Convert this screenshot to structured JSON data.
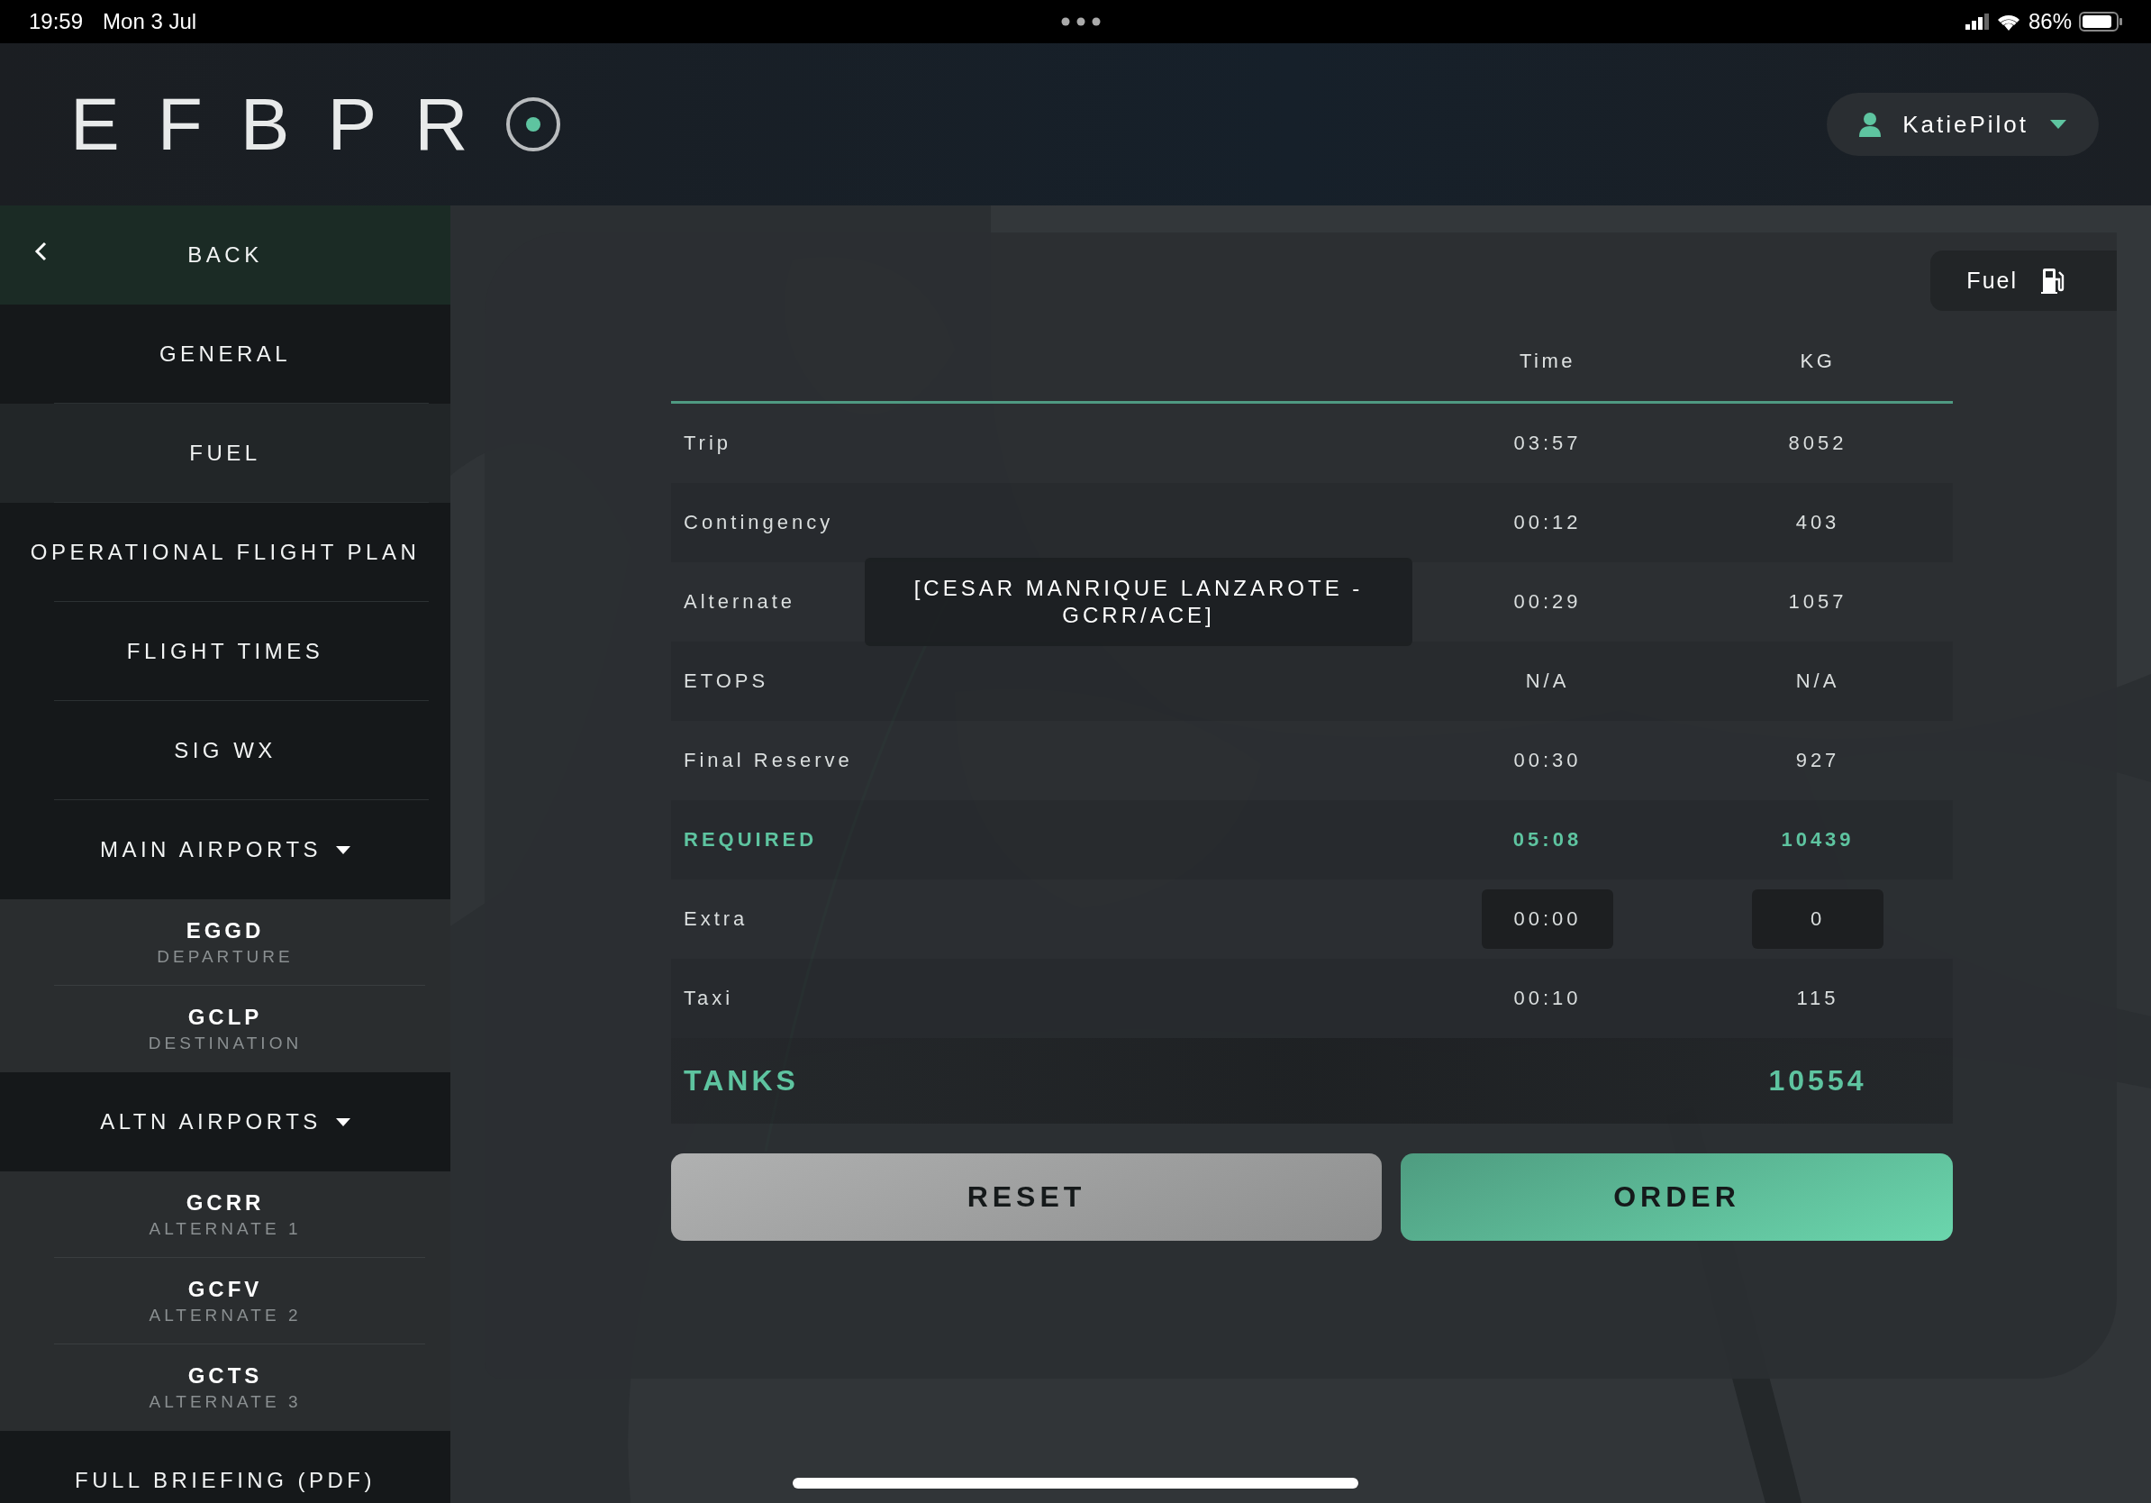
{
  "status_bar": {
    "time": "19:59",
    "date": "Mon 3 Jul",
    "battery": "86%"
  },
  "header": {
    "logo": "EFBPR",
    "user": "KatiePilot"
  },
  "sidebar": {
    "items": [
      {
        "kind": "back",
        "label": "BACK"
      },
      {
        "kind": "item",
        "label": "GENERAL",
        "selected": false
      },
      {
        "kind": "item",
        "label": "FUEL",
        "selected": true
      },
      {
        "kind": "item",
        "label": "OPERATIONAL FLIGHT PLAN",
        "selected": false
      },
      {
        "kind": "item",
        "label": "FLIGHT TIMES",
        "selected": false
      },
      {
        "kind": "item",
        "label": "SIG WX",
        "selected": false
      },
      {
        "kind": "group",
        "label": "MAIN AIRPORTS",
        "expanded": true,
        "children": [
          {
            "code": "EGGD",
            "role": "DEPARTURE",
            "selected": false
          },
          {
            "code": "GCLP",
            "role": "DESTINATION",
            "selected": false
          }
        ]
      },
      {
        "kind": "group",
        "label": "ALTN AIRPORTS",
        "expanded": true,
        "children": [
          {
            "code": "GCRR",
            "role": "ALTERNATE 1",
            "selected": false
          },
          {
            "code": "GCFV",
            "role": "ALTERNATE 2",
            "selected": false
          },
          {
            "code": "GCTS",
            "role": "ALTERNATE 3",
            "selected": false
          }
        ]
      },
      {
        "kind": "item",
        "label": "FULL BRIEFING (PDF)",
        "selected": false
      }
    ]
  },
  "fuel_panel": {
    "tab": "Fuel",
    "columns": [
      "Time",
      "KG"
    ],
    "rows": [
      {
        "kind": "normal",
        "label": "Trip",
        "time": "03:57",
        "kg": "8052"
      },
      {
        "kind": "normal",
        "label": "Contingency",
        "time": "00:12",
        "kg": "403"
      },
      {
        "kind": "normal",
        "label": "Alternate",
        "detail": "[CESAR MANRIQUE LANZAROTE - GCRR/ACE]",
        "time": "00:29",
        "kg": "1057"
      },
      {
        "kind": "normal",
        "label": "ETOPS",
        "time": "N/A",
        "kg": "N/A"
      },
      {
        "kind": "normal",
        "label": "Final Reserve",
        "time": "00:30",
        "kg": "927"
      },
      {
        "kind": "required",
        "label": "REQUIRED",
        "time": "05:08",
        "kg": "10439"
      },
      {
        "kind": "input",
        "label": "Extra",
        "time": "00:00",
        "kg": "0"
      },
      {
        "kind": "normal",
        "label": "Taxi",
        "time": "00:10",
        "kg": "115"
      },
      {
        "kind": "tanks",
        "label": "TANKS",
        "kg": "10554"
      }
    ],
    "buttons": [
      {
        "kind": "reset",
        "label": "RESET"
      },
      {
        "kind": "order",
        "label": "ORDER"
      }
    ]
  }
}
